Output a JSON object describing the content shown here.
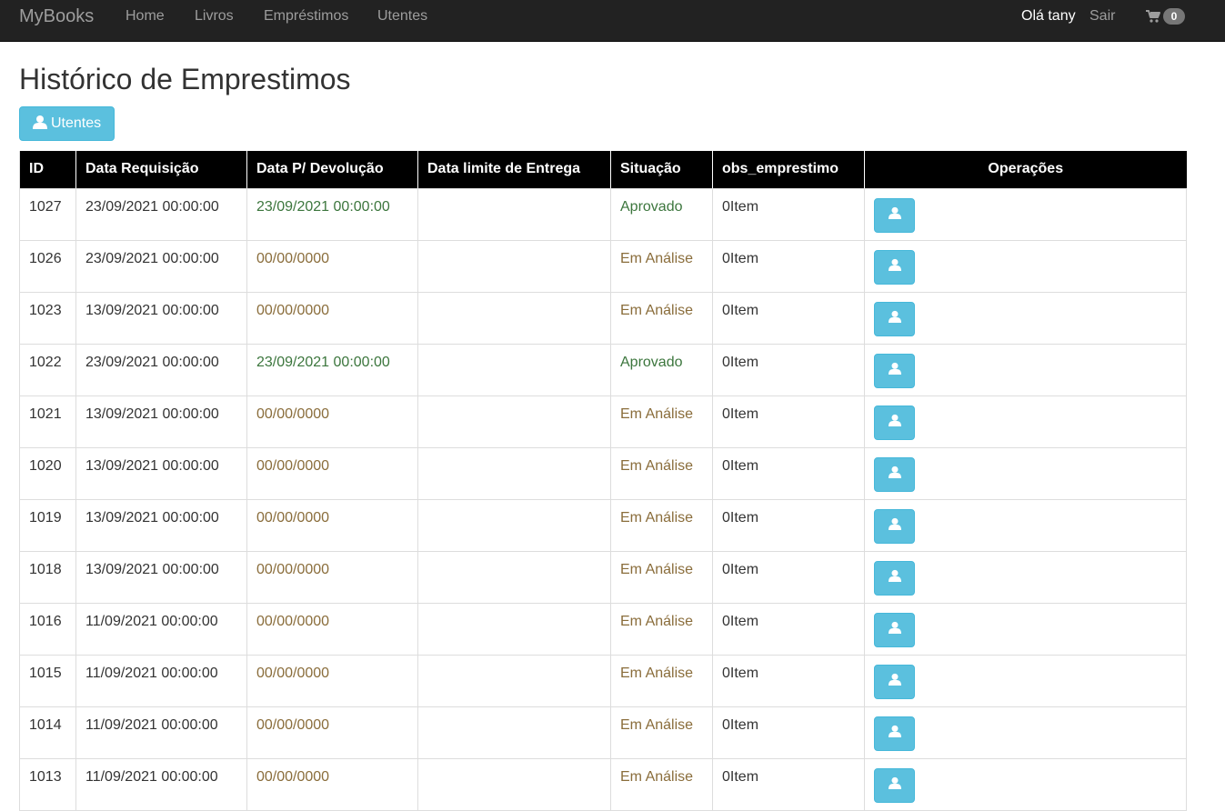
{
  "navbar": {
    "brand": "MyBooks",
    "links": [
      "Home",
      "Livros",
      "Empréstimos",
      "Utentes"
    ],
    "greeting": "Olá tany",
    "logout": "Sair",
    "cart_icon": "shopping-cart-icon",
    "cart_count": "0"
  },
  "page": {
    "title": "Histórico de Emprestimos",
    "utentes_button": "Utentes",
    "utentes_icon": "user-icon"
  },
  "colors": {
    "navbar_bg": "#222222",
    "button_info": "#5bc0de",
    "status_approved": "#3c763d",
    "status_pending": "#8a6d3b"
  },
  "table": {
    "headers": [
      "ID",
      "Data Requisição",
      "Data P/ Devolução",
      "Data limite de Entrega",
      "Situação",
      "obs_emprestimo",
      "Operações"
    ],
    "rows": [
      {
        "id": "1027",
        "data_requisicao": "23/09/2021 00:00:00",
        "data_devolucao": "23/09/2021 00:00:00",
        "data_limite": "",
        "situacao": "Aprovado",
        "status": "success",
        "obs": "0Item"
      },
      {
        "id": "1026",
        "data_requisicao": "23/09/2021 00:00:00",
        "data_devolucao": "00/00/0000",
        "data_limite": "",
        "situacao": "Em Análise",
        "status": "warning",
        "obs": "0Item"
      },
      {
        "id": "1023",
        "data_requisicao": "13/09/2021 00:00:00",
        "data_devolucao": "00/00/0000",
        "data_limite": "",
        "situacao": "Em Análise",
        "status": "warning",
        "obs": "0Item"
      },
      {
        "id": "1022",
        "data_requisicao": "23/09/2021 00:00:00",
        "data_devolucao": "23/09/2021 00:00:00",
        "data_limite": "",
        "situacao": "Aprovado",
        "status": "success",
        "obs": "0Item"
      },
      {
        "id": "1021",
        "data_requisicao": "13/09/2021 00:00:00",
        "data_devolucao": "00/00/0000",
        "data_limite": "",
        "situacao": "Em Análise",
        "status": "warning",
        "obs": "0Item"
      },
      {
        "id": "1020",
        "data_requisicao": "13/09/2021 00:00:00",
        "data_devolucao": "00/00/0000",
        "data_limite": "",
        "situacao": "Em Análise",
        "status": "warning",
        "obs": "0Item"
      },
      {
        "id": "1019",
        "data_requisicao": "13/09/2021 00:00:00",
        "data_devolucao": "00/00/0000",
        "data_limite": "",
        "situacao": "Em Análise",
        "status": "warning",
        "obs": "0Item"
      },
      {
        "id": "1018",
        "data_requisicao": "13/09/2021 00:00:00",
        "data_devolucao": "00/00/0000",
        "data_limite": "",
        "situacao": "Em Análise",
        "status": "warning",
        "obs": "0Item"
      },
      {
        "id": "1016",
        "data_requisicao": "11/09/2021 00:00:00",
        "data_devolucao": "00/00/0000",
        "data_limite": "",
        "situacao": "Em Análise",
        "status": "warning",
        "obs": "0Item"
      },
      {
        "id": "1015",
        "data_requisicao": "11/09/2021 00:00:00",
        "data_devolucao": "00/00/0000",
        "data_limite": "",
        "situacao": "Em Análise",
        "status": "warning",
        "obs": "0Item"
      },
      {
        "id": "1014",
        "data_requisicao": "11/09/2021 00:00:00",
        "data_devolucao": "00/00/0000",
        "data_limite": "",
        "situacao": "Em Análise",
        "status": "warning",
        "obs": "0Item"
      },
      {
        "id": "1013",
        "data_requisicao": "11/09/2021 00:00:00",
        "data_devolucao": "00/00/0000",
        "data_limite": "",
        "situacao": "Em Análise",
        "status": "warning",
        "obs": "0Item"
      }
    ],
    "operation_icon": "user-icon"
  }
}
